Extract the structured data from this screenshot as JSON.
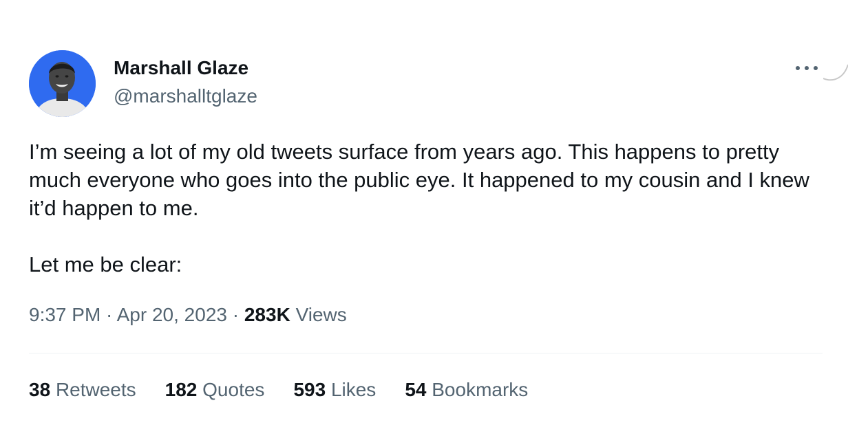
{
  "author": {
    "display_name": "Marshall Glaze",
    "handle": "@marshalltglaze",
    "avatar_bg": "#2f6bf0"
  },
  "tweet": {
    "paragraph_1": "I’m seeing a lot of my old tweets surface from years ago. This happens to pretty much everyone who goes into the public eye. It happened to my cousin and I knew it’d happen to me.",
    "paragraph_2": "Let me be clear:",
    "time": "9:37 PM",
    "date": "Apr 20, 2023",
    "separator": " · ",
    "views_count": "283K",
    "views_label": "Views"
  },
  "stats": {
    "retweets_count": "38",
    "retweets_label": "Retweets",
    "quotes_count": "182",
    "quotes_label": "Quotes",
    "likes_count": "593",
    "likes_label": "Likes",
    "bookmarks_count": "54",
    "bookmarks_label": "Bookmarks"
  },
  "icons": {
    "more": "more-horizontal-icon"
  }
}
